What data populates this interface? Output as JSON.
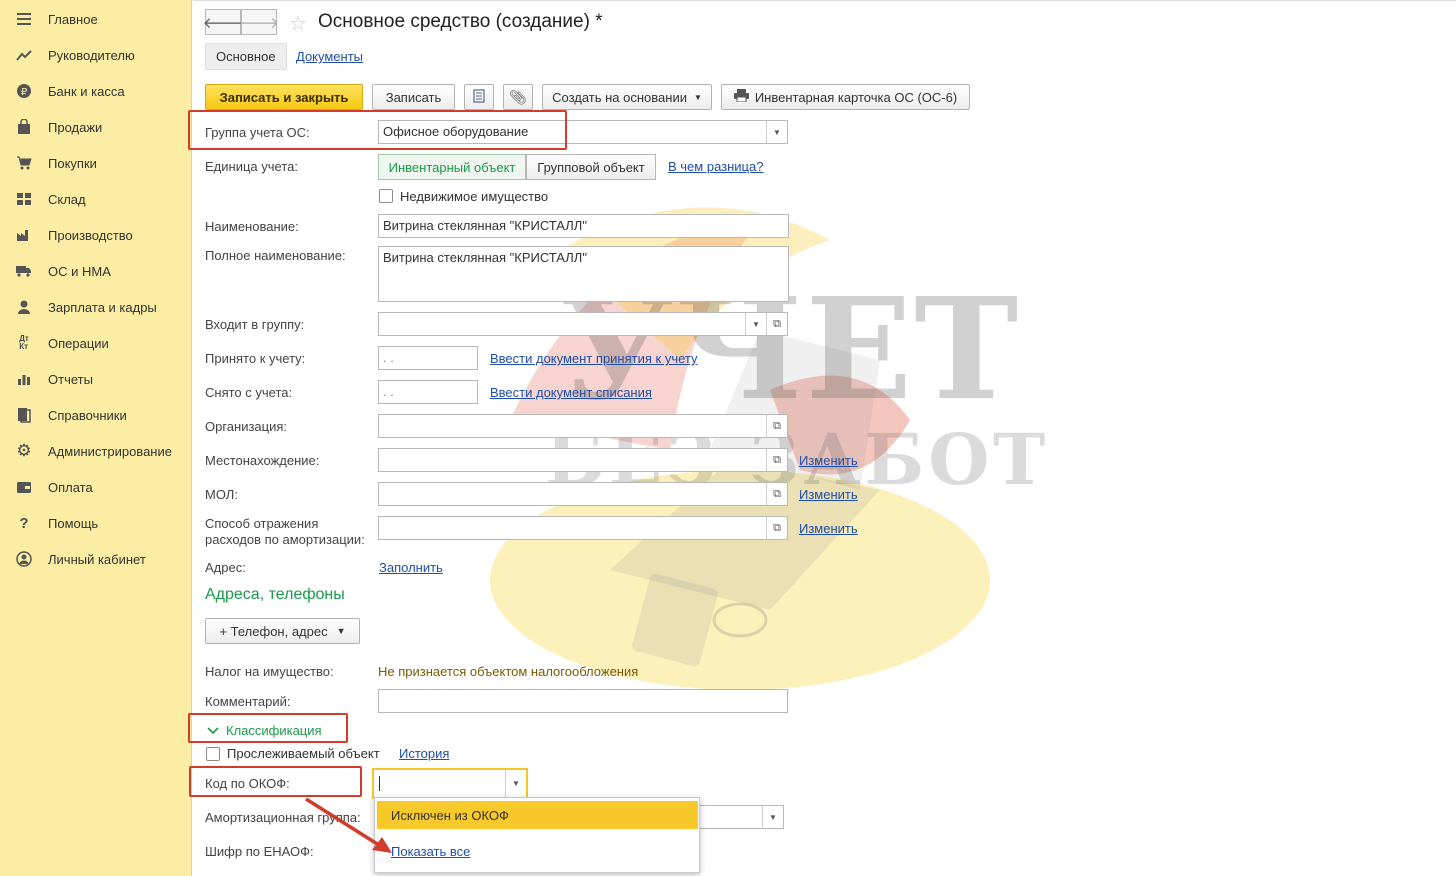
{
  "sidebar": {
    "items": [
      {
        "label": "Главное",
        "icon": "menu-icon"
      },
      {
        "label": "Руководителю",
        "icon": "trend-icon"
      },
      {
        "label": "Банк и касса",
        "icon": "ruble-icon"
      },
      {
        "label": "Продажи",
        "icon": "bag-icon"
      },
      {
        "label": "Покупки",
        "icon": "cart-icon"
      },
      {
        "label": "Склад",
        "icon": "warehouse-icon"
      },
      {
        "label": "Производство",
        "icon": "factory-icon"
      },
      {
        "label": "ОС и НМА",
        "icon": "truck-icon"
      },
      {
        "label": "Зарплата и кадры",
        "icon": "person-icon"
      },
      {
        "label": "Операции",
        "icon": "dtkt-icon"
      },
      {
        "label": "Отчеты",
        "icon": "bar-chart-icon"
      },
      {
        "label": "Справочники",
        "icon": "books-icon"
      },
      {
        "label": "Администрирование",
        "icon": "gear-icon"
      },
      {
        "label": "Оплата",
        "icon": "wallet-icon"
      },
      {
        "label": "Помощь",
        "icon": "question-icon"
      },
      {
        "label": "Личный кабинет",
        "icon": "account-icon"
      }
    ]
  },
  "header": {
    "title": "Основное средство (создание) *",
    "tabs": {
      "main": "Основное",
      "documents": "Документы"
    }
  },
  "toolbar": {
    "save_close": "Записать и закрыть",
    "save": "Записать",
    "create_based": "Создать на основании",
    "inventory_card": "Инвентарная карточка ОС (ОС-6)"
  },
  "form": {
    "group_label": "Группа учета ОС:",
    "group_value": "Офисное оборудование",
    "unit_label": "Единица учета:",
    "unit_opt1": "Инвентарный объект",
    "unit_opt2": "Групповой объект",
    "unit_diff_link": "В чем разница?",
    "realty_label": "Недвижимое имущество",
    "name_label": "Наименование:",
    "name_value": "Витрина стеклянная \"КРИСТАЛЛ\"",
    "fullname_label": "Полное наименование:",
    "fullname_value": "Витрина стеклянная \"КРИСТАЛЛ\"",
    "parent_label": "Входит в группу:",
    "accepted_label": "Принято к учету:",
    "accepted_value": " .  .",
    "accepted_link": "Ввести документ принятия к учету",
    "removed_label": "Снято с учета:",
    "removed_value": " .  .",
    "removed_link": "Ввести документ списания",
    "org_label": "Организация:",
    "location_label": "Местонахождение:",
    "location_link": "Изменить",
    "mol_label": "МОЛ:",
    "mol_link": "Изменить",
    "amort_method_label": "Способ отражения расходов по амортизации:",
    "amort_method_link": "Изменить",
    "address_label": "Адрес:",
    "address_link": "Заполнить",
    "addresses_header": "Адреса, телефоны",
    "phone_button": "+ Телефон, адрес",
    "tax_label": "Налог на имущество:",
    "tax_value": "Не признается объектом налогообложения",
    "comment_label": "Комментарий:",
    "classification_header": "Классификация",
    "tracked_label": "Прослеживаемый объект",
    "history_link": "История",
    "okof_label": "Код по ОКОФ:",
    "amort_group_label": "Амортизационная группа:",
    "enaof_label": "Шифр по ЕНАОФ:"
  },
  "dropdown": {
    "option1": "Исключен из ОКОФ",
    "option2": "Показать все"
  },
  "watermark": {
    "line1": "УЧЕТ",
    "line2": "БЕЗ ЗАБОТ"
  },
  "colors": {
    "sidebar_bg": "#fbeea4",
    "primary_button": "#f6c915",
    "highlight_red": "#d23c2a",
    "section_green": "#1a9a4a",
    "tax_text": "#7a5a00",
    "link_blue": "#1f4ea8"
  }
}
